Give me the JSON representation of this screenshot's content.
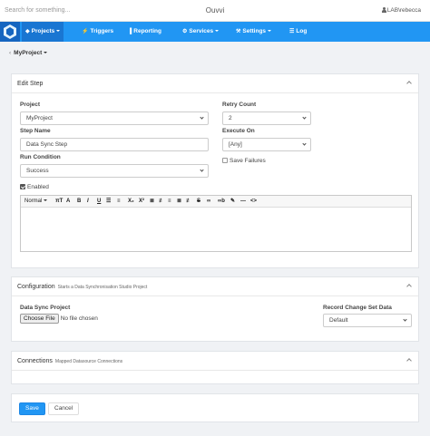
{
  "topbar": {
    "search_placeholder": "Search for something...",
    "brand": "Ouvvi",
    "user": "LAB\\rebecca"
  },
  "nav": {
    "items": [
      {
        "label": "Projects",
        "icon": "projects-icon",
        "glyph": "◆"
      },
      {
        "label": "Triggers",
        "icon": "bolt-icon",
        "glyph": "⚡"
      },
      {
        "label": "Reporting",
        "icon": "chart-icon",
        "glyph": "▐"
      },
      {
        "label": "Services",
        "icon": "gears-icon",
        "glyph": "⚙"
      },
      {
        "label": "Settings",
        "icon": "wrench-icon",
        "glyph": "⚒"
      },
      {
        "label": "Log",
        "icon": "list-icon",
        "glyph": "☰"
      }
    ]
  },
  "breadcrumb": {
    "back": "‹",
    "project": "MyProject"
  },
  "edit_step": {
    "title": "Edit Step",
    "project_label": "Project",
    "project_value": "MyProject",
    "step_name_label": "Step Name",
    "step_name_value": "Data Sync Step",
    "run_condition_label": "Run Condition",
    "run_condition_value": "Success",
    "enabled_label": "Enabled",
    "enabled": true,
    "retry_label": "Retry Count",
    "retry_value": "2",
    "execute_label": "Execute On",
    "execute_value": "[Any]",
    "save_failures_label": "Save Failures",
    "save_failures": false
  },
  "editor_toolbar": {
    "format": "Normal",
    "buttons": [
      "·",
      "πT",
      "A",
      "B",
      "I",
      "U",
      "☰",
      "≡",
      "X₂",
      "X²",
      "≣",
      "≢",
      "≡",
      "≣",
      "≢",
      "S",
      "∞",
      "∞b",
      "✎",
      "—",
      "<>"
    ]
  },
  "configuration": {
    "title": "Configuration",
    "subtitle": "Starts a Data Synchronisation Studio Project",
    "data_sync_label": "Data Sync Project",
    "choose_file": "Choose File",
    "no_file": "No file chosen",
    "record_change_label": "Record Change Set Data",
    "record_change_value": "Default"
  },
  "connections": {
    "title": "Connections",
    "subtitle": "Mapped Datasource Connections"
  },
  "actions": {
    "save": "Save",
    "cancel": "Cancel"
  }
}
